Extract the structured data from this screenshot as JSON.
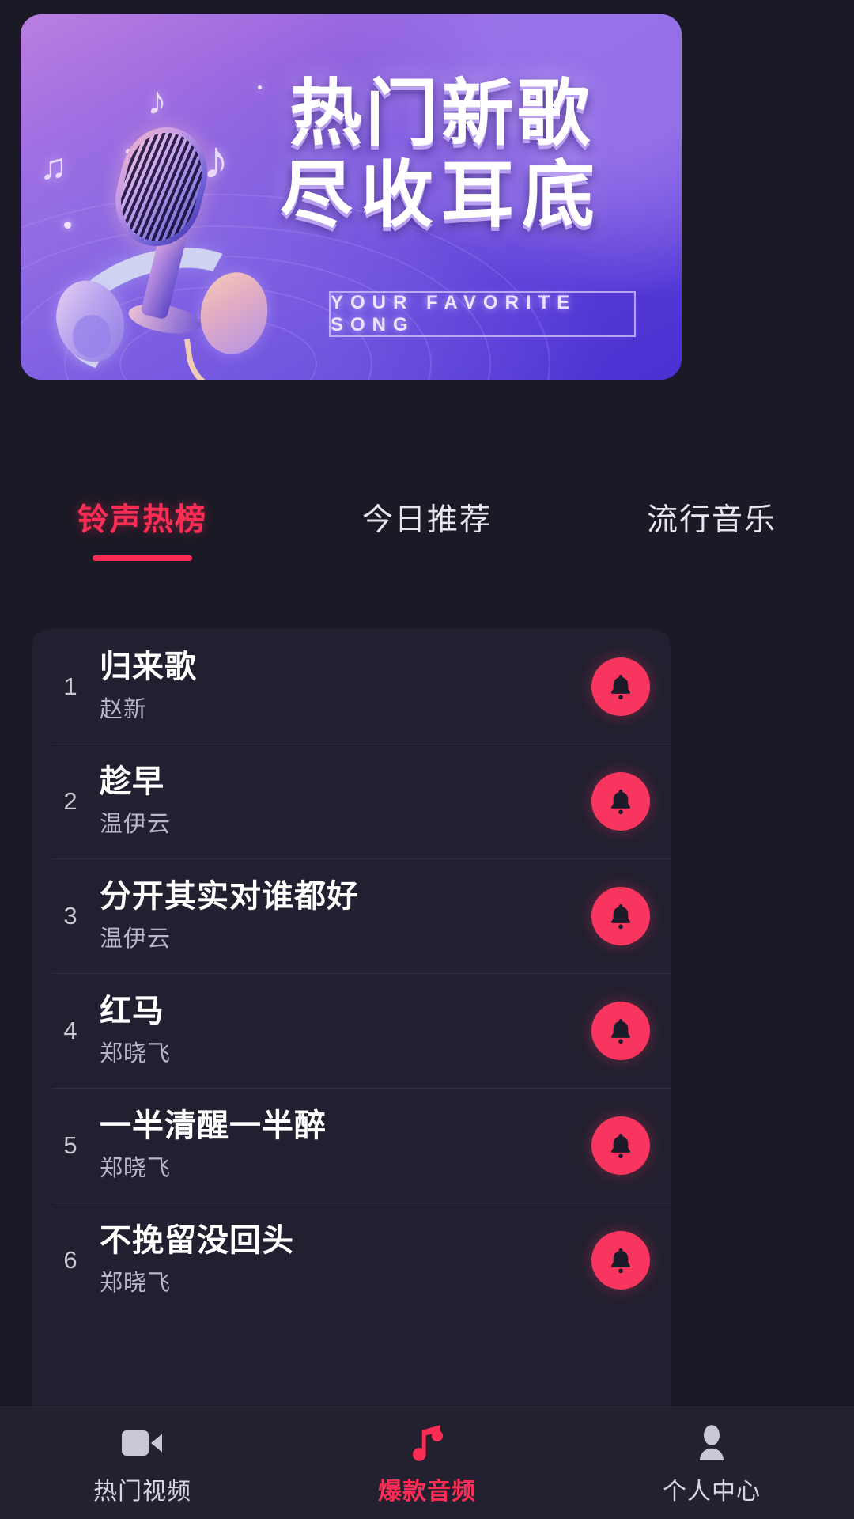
{
  "banner": {
    "title_line1": "热门新歌",
    "title_line2": "尽收耳底",
    "tagline": "YOUR FAVORITE SONG",
    "gradient_from": "#bb7fe0",
    "gradient_to": "#4a2fd2"
  },
  "tabs": [
    {
      "label": "铃声热榜",
      "active": true
    },
    {
      "label": "今日推荐",
      "active": false
    },
    {
      "label": "流行音乐",
      "active": false
    }
  ],
  "accent_color": "#fb2d55",
  "songs": [
    {
      "rank": "1",
      "title": "归来歌",
      "artist": "赵新",
      "action": "bell-icon"
    },
    {
      "rank": "2",
      "title": "趁早",
      "artist": "温伊云",
      "action": "bell-icon"
    },
    {
      "rank": "3",
      "title": "分开其实对谁都好",
      "artist": "温伊云",
      "action": "bell-icon"
    },
    {
      "rank": "4",
      "title": "红马",
      "artist": "郑晓飞",
      "action": "bell-icon"
    },
    {
      "rank": "5",
      "title": "一半清醒一半醉",
      "artist": "郑晓飞",
      "action": "bell-icon"
    },
    {
      "rank": "6",
      "title": "不挽留没回头",
      "artist": "郑晓飞",
      "action": "bell-icon"
    }
  ],
  "bottom_nav": [
    {
      "label": "热门视频",
      "icon": "video-camera-icon",
      "active": false
    },
    {
      "label": "爆款音频",
      "icon": "music-note-icon",
      "active": true
    },
    {
      "label": "个人中心",
      "icon": "person-icon",
      "active": false
    }
  ]
}
